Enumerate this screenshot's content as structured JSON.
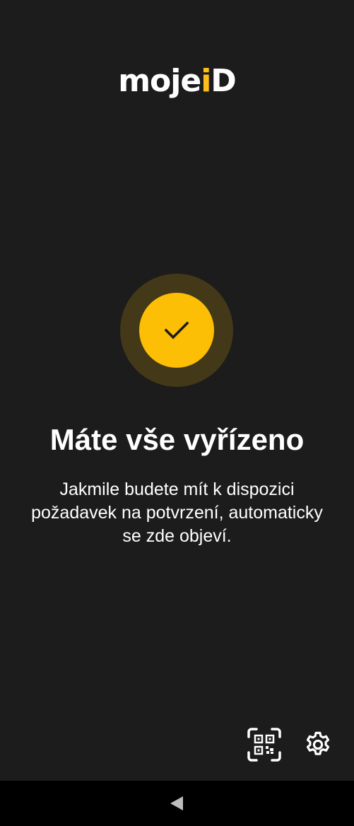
{
  "app": {
    "logo_text_prefix": "moje",
    "logo_text_i": "i",
    "logo_text_suffix": "D",
    "accent_color": "#fdbe06",
    "background_color": "#1c1c1c"
  },
  "status": {
    "icon": "check-icon",
    "title": "Máte vše vyřízeno",
    "message": "Jakmile budete mít k dispozici požadavek na potvrzení, automaticky se zde objeví."
  },
  "actions": {
    "qr_icon": "qr-scan-icon",
    "settings_icon": "gear-icon"
  },
  "navigation": {
    "back_icon": "back-triangle-icon"
  }
}
